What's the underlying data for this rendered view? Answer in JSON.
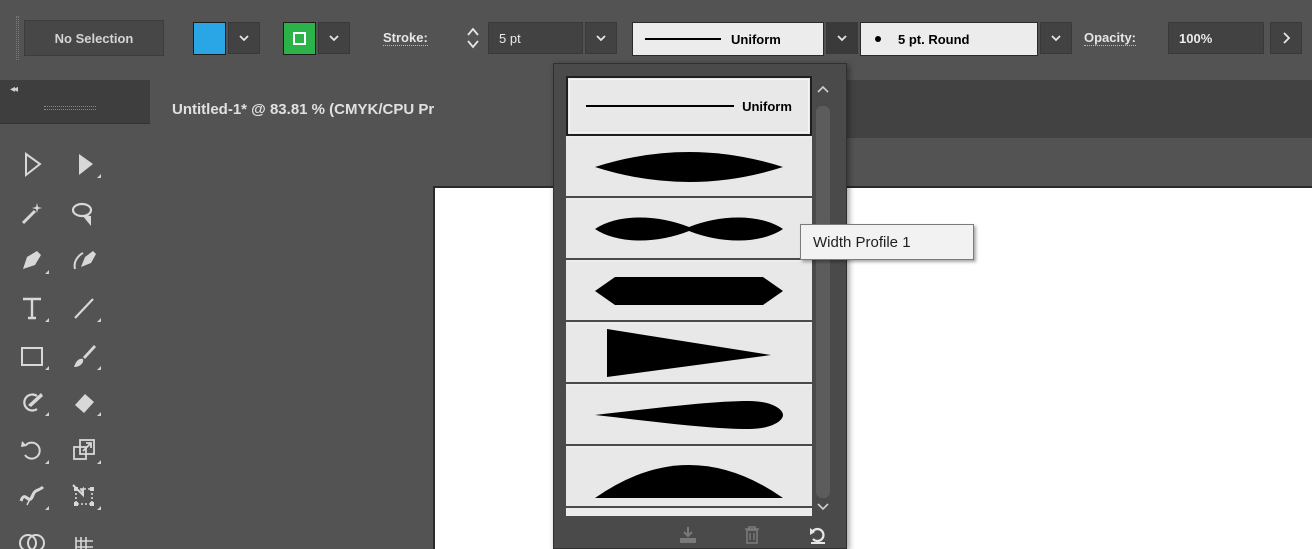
{
  "control_bar": {
    "selection_label": "No Selection",
    "fill_color": "#2aa6e6",
    "stroke_color": "#2bb34a",
    "stroke_label": "Stroke:",
    "stroke_weight": "5 pt",
    "profile_label": "Uniform",
    "brush_label": "5 pt. Round",
    "opacity_label": "Opacity:",
    "opacity_value": "100%"
  },
  "tools": {
    "collapse_glyph": "◂◂",
    "items": [
      {
        "name": "selection-tool-icon"
      },
      {
        "name": "direct-selection-tool-icon"
      },
      {
        "name": "magic-wand-tool-icon"
      },
      {
        "name": "lasso-tool-icon"
      },
      {
        "name": "pen-tool-icon"
      },
      {
        "name": "curvature-tool-icon"
      },
      {
        "name": "type-tool-icon"
      },
      {
        "name": "line-segment-tool-icon"
      },
      {
        "name": "rectangle-tool-icon"
      },
      {
        "name": "paintbrush-tool-icon"
      },
      {
        "name": "shaper-tool-icon"
      },
      {
        "name": "eraser-tool-icon"
      },
      {
        "name": "rotate-tool-icon"
      },
      {
        "name": "scale-tool-icon"
      },
      {
        "name": "width-tool-icon"
      },
      {
        "name": "free-transform-tool-icon"
      },
      {
        "name": "shape-builder-tool-icon"
      },
      {
        "name": "perspective-grid-tool-icon"
      }
    ]
  },
  "document": {
    "tab_title": "Untitled-1* @ 83.81 % (CMYK/CPU Pr"
  },
  "profile_dropdown": {
    "items": [
      {
        "label": "Uniform",
        "selected": true
      },
      {
        "label": "",
        "selected": false
      },
      {
        "label": "",
        "selected": false
      },
      {
        "label": "",
        "selected": false
      },
      {
        "label": "",
        "selected": false
      },
      {
        "label": "",
        "selected": false
      },
      {
        "label": "",
        "selected": false
      }
    ],
    "footer_icons": [
      "add-to-profiles-icon",
      "delete-profile-icon",
      "reset-profiles-icon"
    ]
  },
  "tooltip": {
    "text": "Width Profile 1"
  }
}
